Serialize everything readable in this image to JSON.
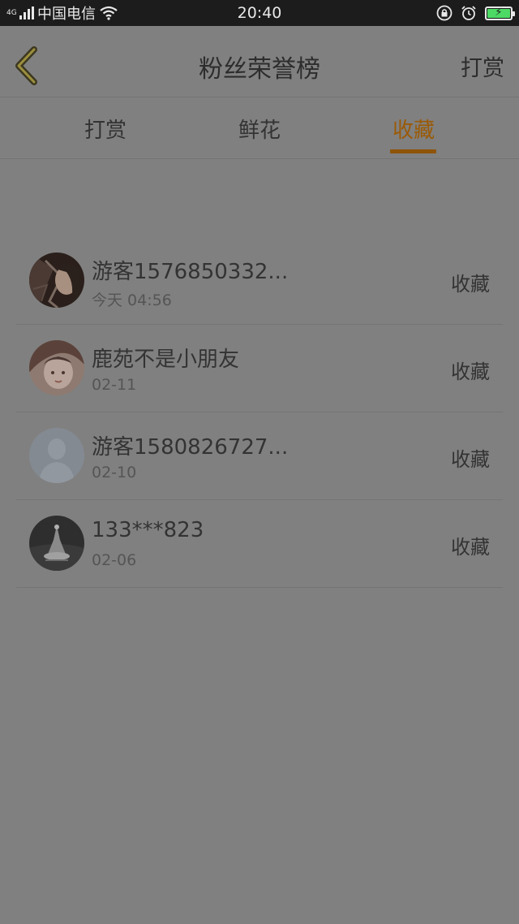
{
  "status_bar": {
    "network": "4G",
    "carrier": "中国电信",
    "time": "20:40",
    "icons": [
      "signal-icon",
      "wifi-icon",
      "rotation-lock-icon",
      "alarm-icon",
      "battery-charging-icon"
    ]
  },
  "header": {
    "title": "粉丝荣誉榜",
    "right_action": "打赏",
    "back_icon": "chevron-left-icon"
  },
  "tabs": [
    {
      "label": "打赏",
      "active": false
    },
    {
      "label": "鲜花",
      "active": false
    },
    {
      "label": "收藏",
      "active": true
    }
  ],
  "list": [
    {
      "name": "游客1576850332...",
      "time": "今天 04:56",
      "action": "收藏"
    },
    {
      "name": "鹿苑不是小朋友",
      "time": "02-11",
      "action": "收藏"
    },
    {
      "name": "游客1580826727...",
      "time": "02-10",
      "action": "收藏"
    },
    {
      "name": "133***823",
      "time": "02-06",
      "action": "收藏"
    }
  ],
  "colors": {
    "accent": "#9a5a06",
    "overlay": "#808080",
    "status_bar": "#1c1c1c"
  }
}
